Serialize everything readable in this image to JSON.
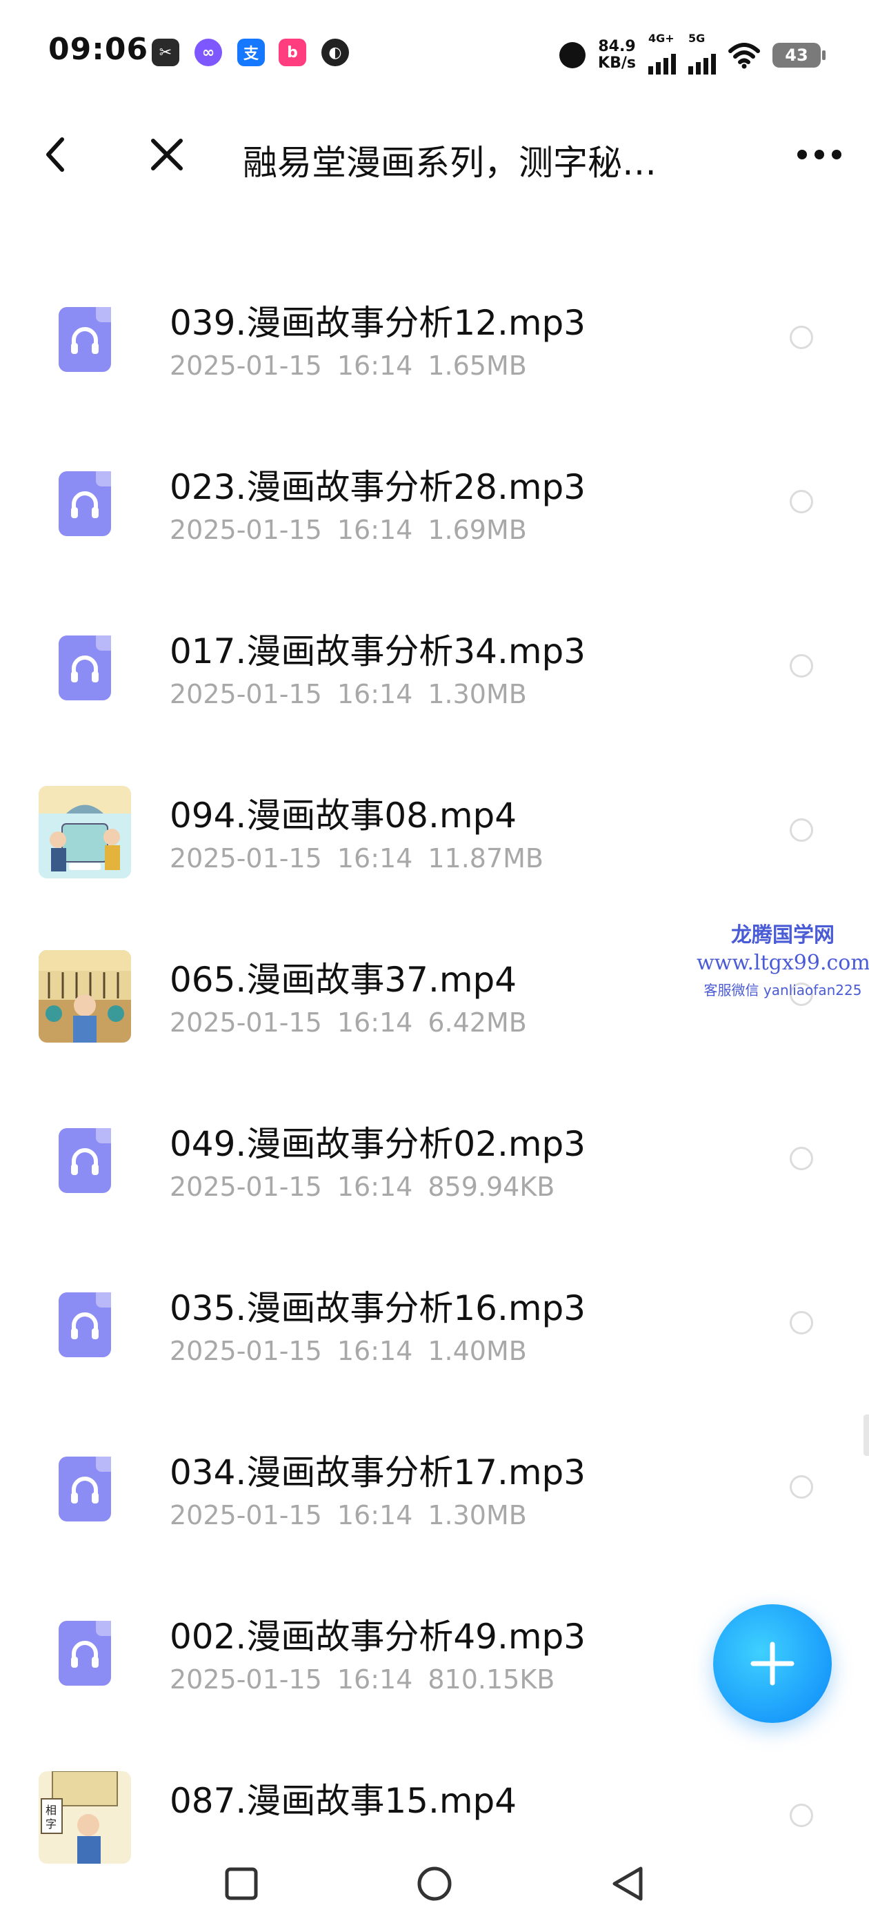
{
  "status_bar": {
    "time": "09:06",
    "net_speed_value": "84.9",
    "net_speed_unit": "KB/s",
    "sim1_label": "4G+",
    "sim2_label": "5G",
    "battery": "43",
    "notification_icons": [
      "capcut-icon",
      "loop-app-icon",
      "alipay-icon",
      "bilibili-icon",
      "browser-icon"
    ]
  },
  "header": {
    "title": "融易堂漫画系列，测字秘…",
    "back_icon": "chevron-left-icon",
    "close_icon": "close-icon",
    "more_icon": "more-dots-icon"
  },
  "files": [
    {
      "name": "039.漫画故事分析12.mp3",
      "date": "2025-01-15",
      "time": "16:14",
      "size": "1.65MB",
      "type": "audio"
    },
    {
      "name": "023.漫画故事分析28.mp3",
      "date": "2025-01-15",
      "time": "16:14",
      "size": "1.69MB",
      "type": "audio"
    },
    {
      "name": "017.漫画故事分析34.mp3",
      "date": "2025-01-15",
      "time": "16:14",
      "size": "1.30MB",
      "type": "audio"
    },
    {
      "name": "094.漫画故事08.mp4",
      "date": "2025-01-15",
      "time": "16:14",
      "size": "11.87MB",
      "type": "video"
    },
    {
      "name": "065.漫画故事37.mp4",
      "date": "2025-01-15",
      "time": "16:14",
      "size": "6.42MB",
      "type": "video"
    },
    {
      "name": "049.漫画故事分析02.mp3",
      "date": "2025-01-15",
      "time": "16:14",
      "size": "859.94KB",
      "type": "audio"
    },
    {
      "name": "035.漫画故事分析16.mp3",
      "date": "2025-01-15",
      "time": "16:14",
      "size": "1.40MB",
      "type": "audio"
    },
    {
      "name": "034.漫画故事分析17.mp3",
      "date": "2025-01-15",
      "time": "16:14",
      "size": "1.30MB",
      "type": "audio"
    },
    {
      "name": "002.漫画故事分析49.mp3",
      "date": "2025-01-15",
      "time": "16:14",
      "size": "810.15KB",
      "type": "audio"
    },
    {
      "name": "087.漫画故事15.mp4",
      "type": "video"
    }
  ],
  "watermark": {
    "line1": "龙腾国学网",
    "line2": "www.ltgx99.com",
    "line3": "客服微信 yanliaofan225"
  },
  "colors": {
    "accent": "#1a9dfb",
    "audio_icon": "#8c8cf5",
    "meta_text": "#a8a8a8",
    "watermark": "#4a5bd6"
  }
}
